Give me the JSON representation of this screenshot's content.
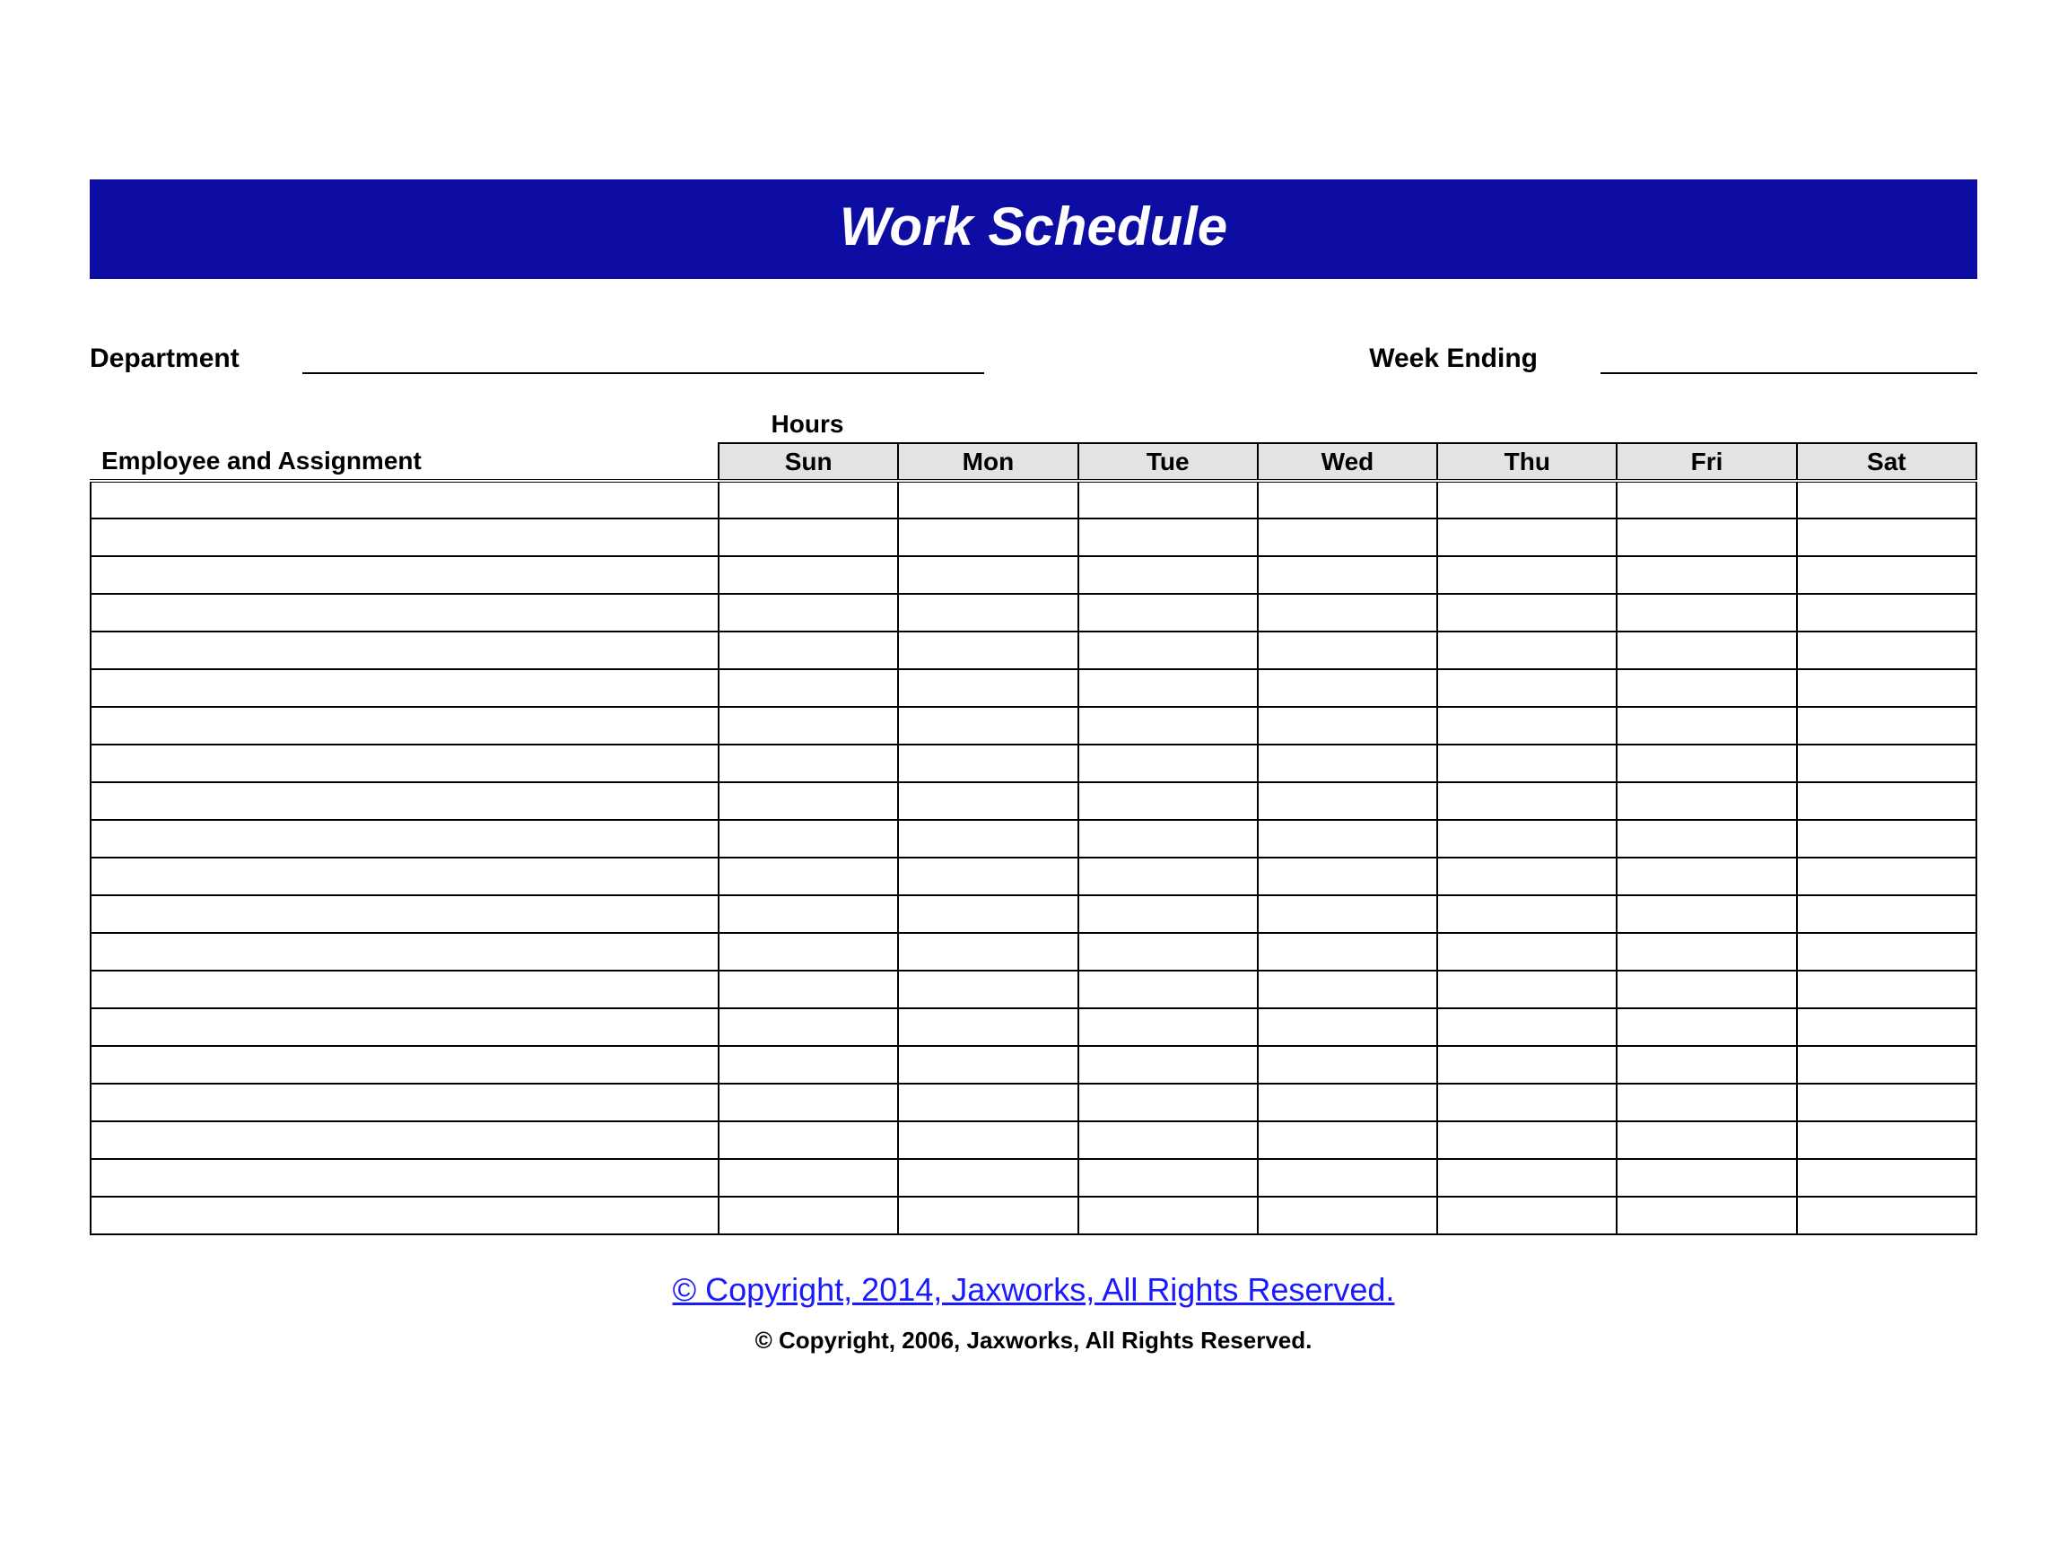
{
  "title": "Work Schedule",
  "meta": {
    "department_label": "Department",
    "week_ending_label": "Week Ending",
    "department_value": "",
    "week_ending_value": ""
  },
  "table": {
    "hours_label": "Hours",
    "employee_header": "Employee and Assignment",
    "days": [
      "Sun",
      "Mon",
      "Tue",
      "Wed",
      "Thu",
      "Fri",
      "Sat"
    ],
    "row_count": 20
  },
  "footer": {
    "link_text": "© Copyright, 2014, Jaxworks, All Rights Reserved.",
    "sub_text": "© Copyright, 2006, Jaxworks, All Rights Reserved."
  }
}
